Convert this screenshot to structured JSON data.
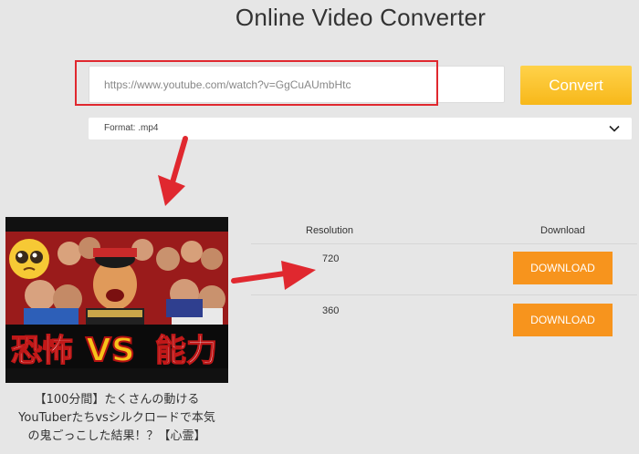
{
  "page": {
    "title": "Online Video Converter"
  },
  "converter": {
    "url_value": "https://www.youtube.com/watch?v=GgCuAUmbHtc",
    "convert_label": "Convert",
    "format_label": "Format: .mp4"
  },
  "video": {
    "thumbnail_text": {
      "left": "恐怖",
      "middle": "VS",
      "right": "能力"
    },
    "caption_lines": [
      "【100分間】たくさんの動ける",
      "YouTuberたちvsシルクロードで本気",
      "の鬼ごっこした結果！？【心霊】"
    ]
  },
  "results": {
    "headers": {
      "resolution": "Resolution",
      "download": "Download"
    },
    "rows": [
      {
        "resolution": "720",
        "button": "DOWNLOAD"
      },
      {
        "resolution": "360",
        "button": "DOWNLOAD"
      }
    ]
  },
  "colors": {
    "accent": "#f7941d",
    "convert": "#f7b81a",
    "annotation": "#e0282f"
  }
}
